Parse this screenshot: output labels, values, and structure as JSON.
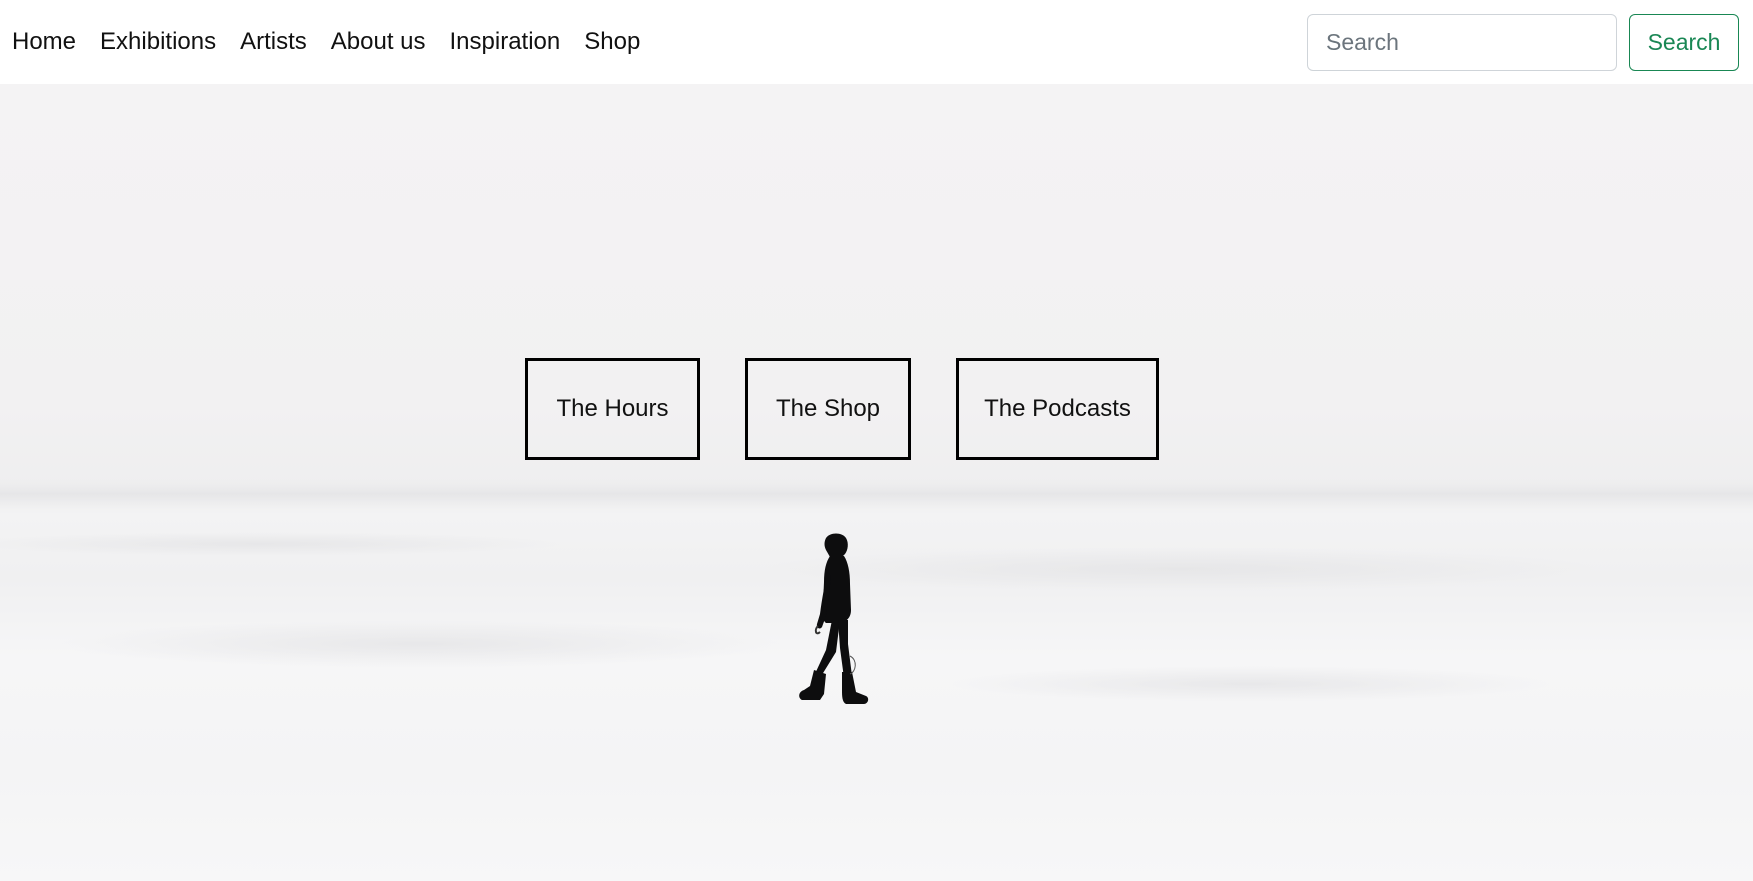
{
  "nav": {
    "links": [
      {
        "label": "Home"
      },
      {
        "label": "Exhibitions"
      },
      {
        "label": "Artists"
      },
      {
        "label": "About us"
      },
      {
        "label": "Inspiration"
      },
      {
        "label": "Shop"
      }
    ]
  },
  "search": {
    "placeholder": "Search",
    "value": "",
    "button_label": "Search",
    "button_color": "#198754"
  },
  "hero": {
    "buttons": [
      {
        "label": "The Hours"
      },
      {
        "label": "The Shop"
      },
      {
        "label": "The Podcasts"
      }
    ]
  }
}
